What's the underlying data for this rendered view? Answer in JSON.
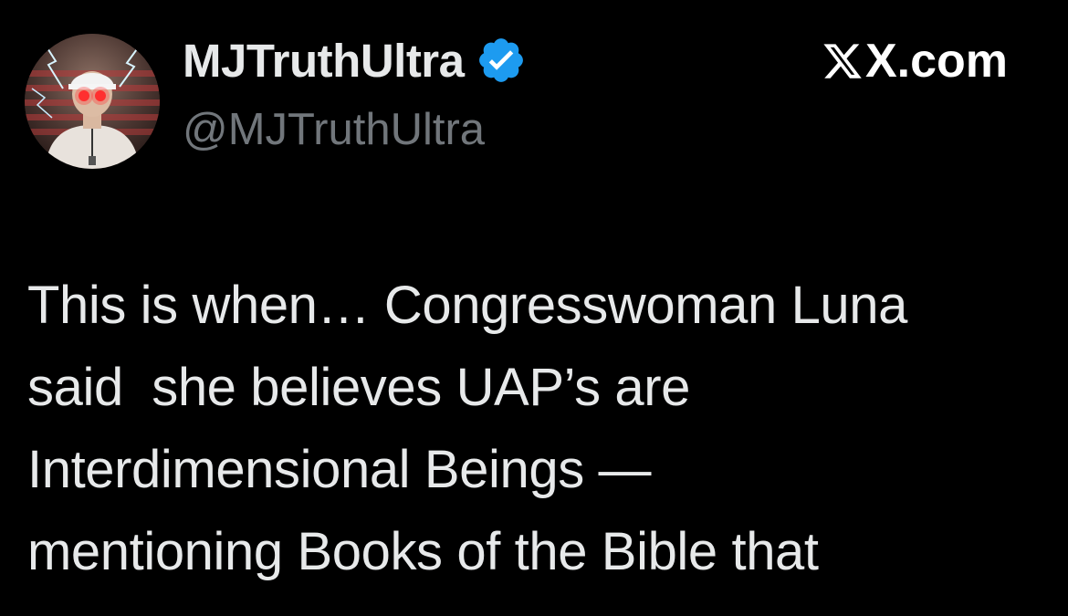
{
  "tweet": {
    "author": {
      "display_name": "MJTruthUltra",
      "handle": "@MJTruthUltra",
      "verified": true,
      "verified_badge_color": "#1d9bf0"
    },
    "site_label": "X.com",
    "site_icon": "x-logo-icon",
    "text_lines": [
      "This is when… Congresswoman Luna",
      "said  she believes UAP’s are",
      "Interdimensional Beings —",
      "mentioning Books of the Bible that"
    ],
    "colors": {
      "background": "#000000",
      "primary_text": "#e7e9ea",
      "secondary_text": "#71767b"
    }
  }
}
